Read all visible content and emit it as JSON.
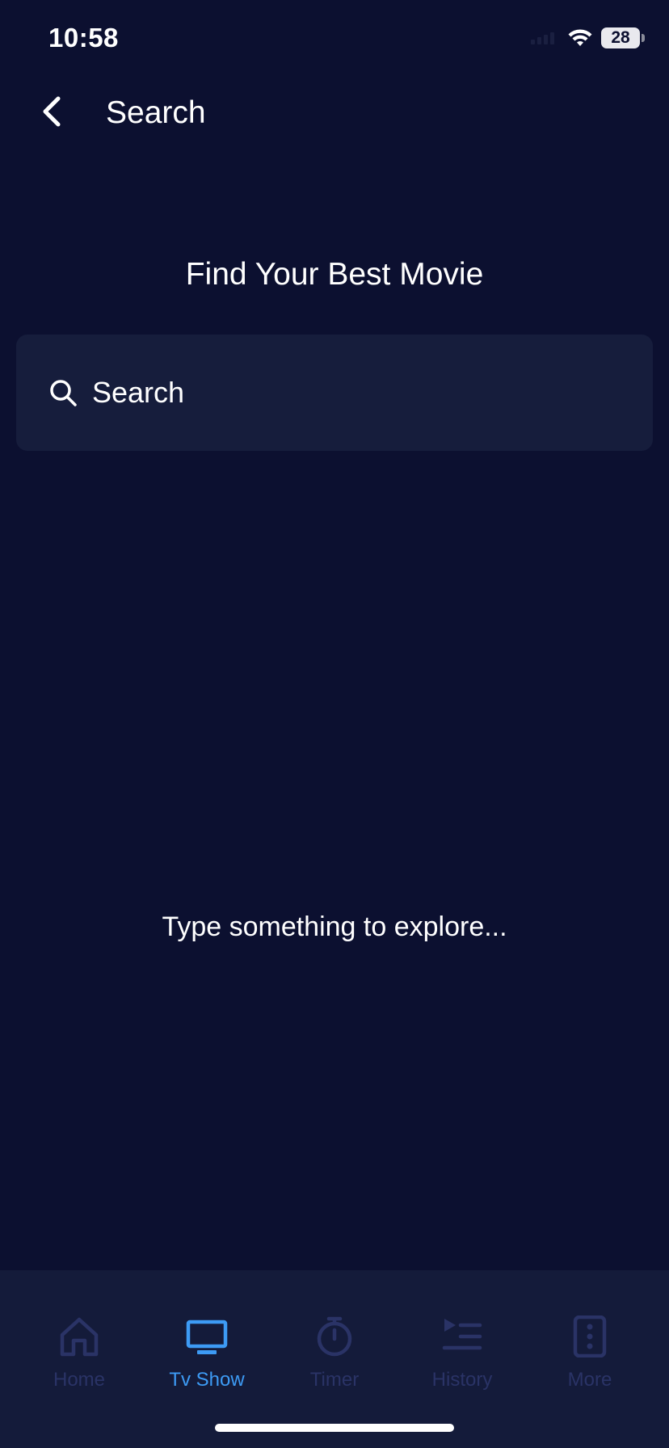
{
  "status_bar": {
    "time": "10:58",
    "battery": "28"
  },
  "header": {
    "title": "Search"
  },
  "main": {
    "headline": "Find Your Best Movie",
    "search": {
      "placeholder": "Search"
    },
    "empty_message": "Type something to explore..."
  },
  "tab_bar": {
    "items": [
      {
        "label": "Home",
        "icon": "home-icon"
      },
      {
        "label": "Tv Show",
        "icon": "tv-icon"
      },
      {
        "label": "Timer",
        "icon": "stopwatch-icon"
      },
      {
        "label": "History",
        "icon": "playlist-icon"
      },
      {
        "label": "More",
        "icon": "more-icon"
      }
    ],
    "active_index": 1
  },
  "colors": {
    "background": "#0c1030",
    "surface": "#161d3c",
    "tab_bar": "#141b3a",
    "accent": "#3d9bf5",
    "inactive": "#2a3366"
  }
}
